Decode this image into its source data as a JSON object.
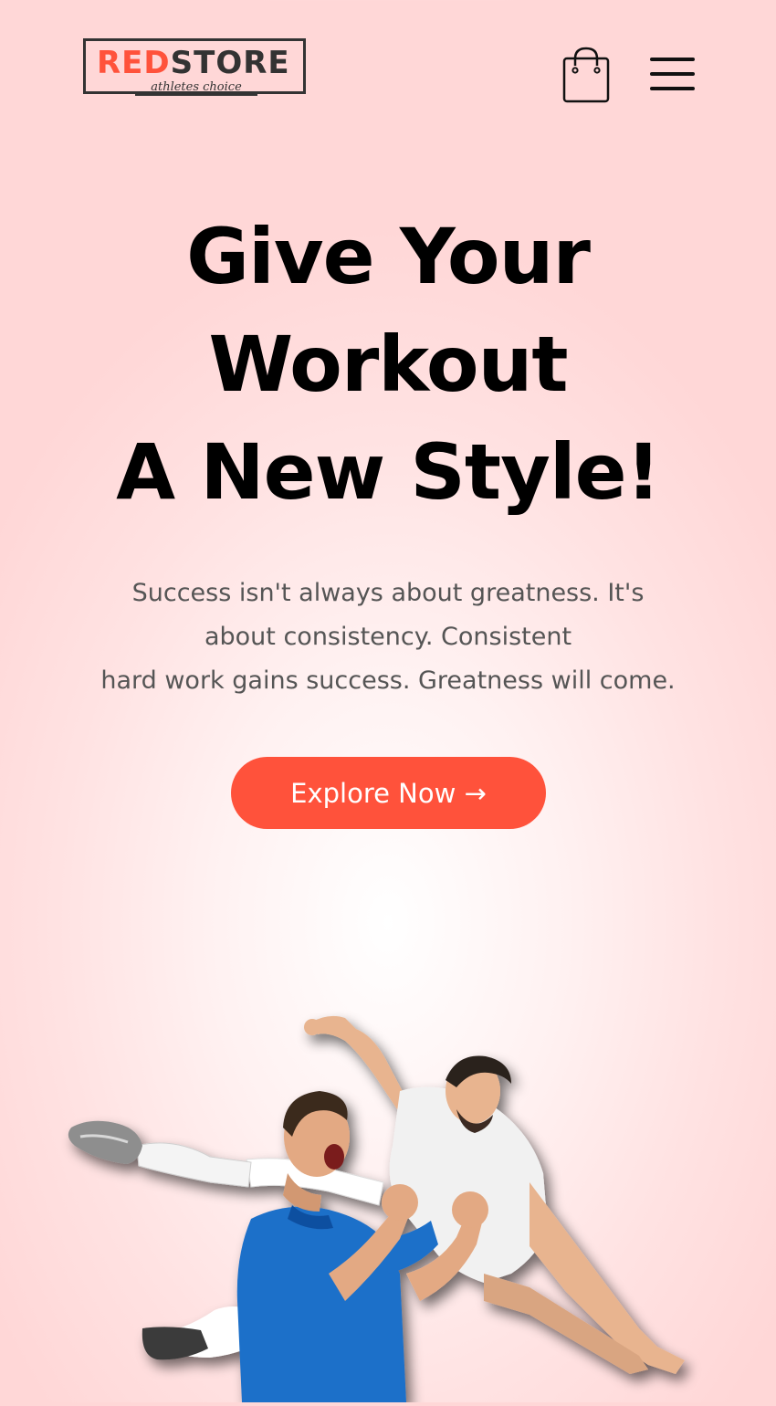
{
  "header": {
    "logo": {
      "brand_part1": "RED",
      "brand_part2": "STORE",
      "tagline": "athletes choice"
    },
    "cart_icon": "shopping-bag-icon",
    "menu_icon": "hamburger-menu-icon"
  },
  "hero": {
    "headline": [
      "Give Your",
      "Workout",
      "A New Style!"
    ],
    "subtext": [
      "Success isn't always about greatness. It's",
      "about consistency. Consistent",
      "hard work gains success. Greatness will come."
    ],
    "cta_label": "Explore Now →",
    "image": "football-players-celebrating"
  },
  "colors": {
    "accent": "#ff523b",
    "text_dark": "#000000",
    "text_muted": "#555555",
    "background_tint": "#ffd6d6"
  }
}
